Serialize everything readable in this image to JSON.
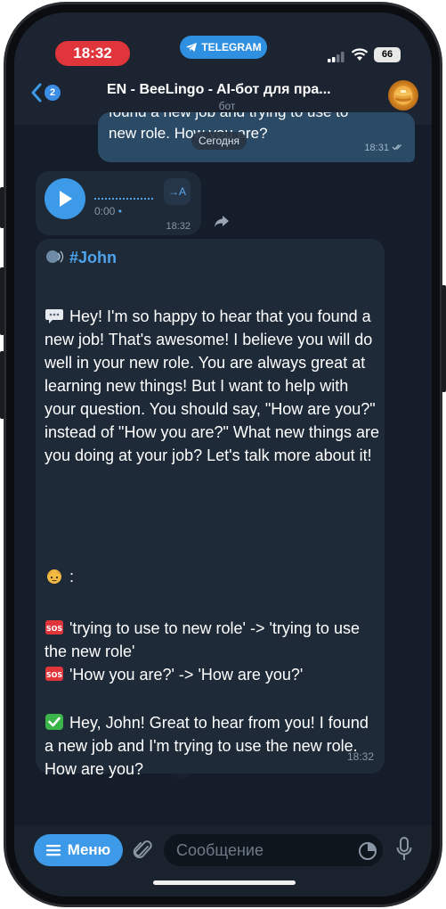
{
  "status_bar": {
    "time": "18:32",
    "app_pill": "TELEGRAM",
    "battery": "66"
  },
  "header": {
    "back_badge": "2",
    "title": "EN - BeeLingo - AI-бот для пра...",
    "subtitle": "бот"
  },
  "messages": {
    "outgoing": {
      "line1": "found a new job and trying to use to",
      "line2": "new role. How you are?",
      "time": "18:31"
    },
    "date_chip": "Сегодня",
    "voice": {
      "duration": "0:00",
      "transcribe_label": "→A",
      "time": "18:32"
    },
    "reply": {
      "hashtag": "#John",
      "paragraph1": "Hey! I'm so happy to hear that you found a new job! That's awesome! I believe you will do well in your new role. You are always great at learning new things! But I want to help with your question. You should say, \"How are you?\" instead of \"How you are?\" What new things are you doing at your job? Let's talk more about it!",
      "section_label": ":",
      "correction1": "'trying to use to new role' -> 'trying to use the new role'",
      "correction2": "'How you are?' -> 'How are you?'",
      "corrected_text": "Hey, John! Great to hear from you! I found a new job and I'm trying to use the new role. How are you?",
      "time": "18:32"
    }
  },
  "input_bar": {
    "menu_label": "Меню",
    "placeholder": "Сообщение"
  },
  "colors": {
    "accent": "#3d9ae8",
    "bubble_in": "#1f2a38",
    "bubble_out": "#2b4a66",
    "background": "#141d29",
    "time_pill": "#e0353a"
  }
}
